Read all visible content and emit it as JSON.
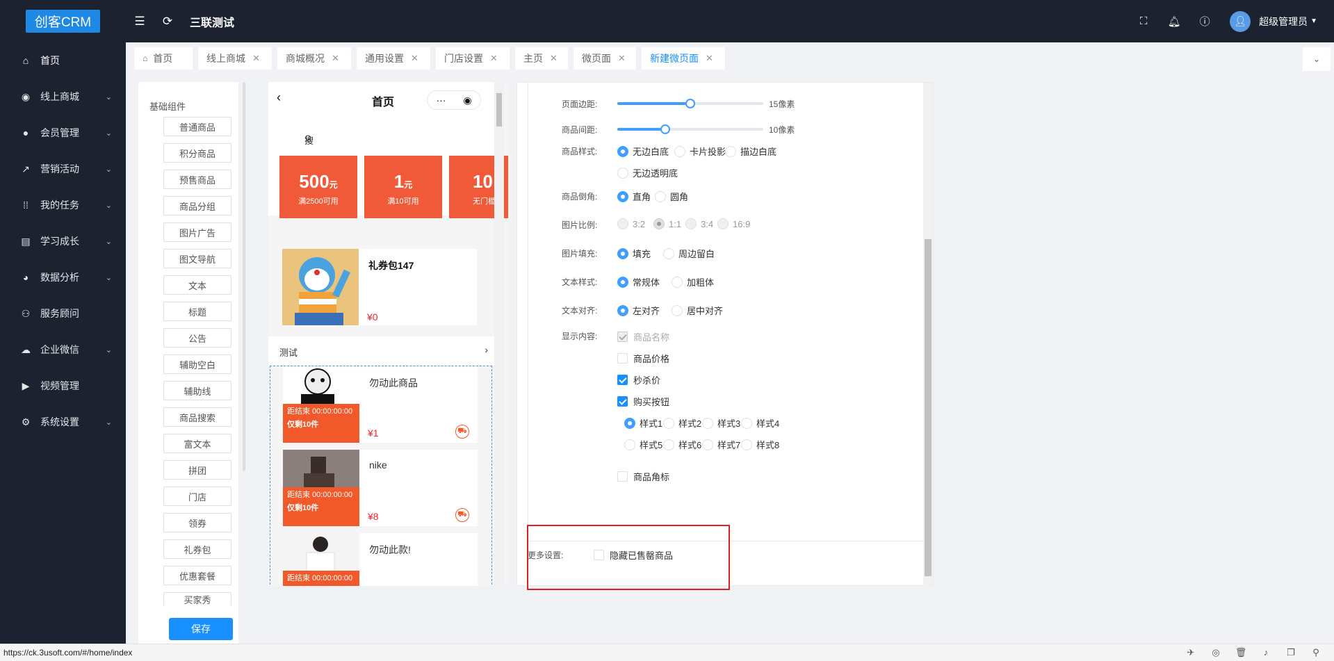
{
  "app": {
    "logo": "创客CRM",
    "store_title": "三联测试",
    "user_name": "超级管理员",
    "url": "https://ck.3usoft.com/#/home/index"
  },
  "sidebar": {
    "items": [
      {
        "label": "首页",
        "icon": "home-icon"
      },
      {
        "label": "线上商城",
        "icon": "store-icon"
      },
      {
        "label": "会员管理",
        "icon": "user-icon"
      },
      {
        "label": "营销活动",
        "icon": "trend-icon"
      },
      {
        "label": "我的任务",
        "icon": "grid-icon"
      },
      {
        "label": "学习成长",
        "icon": "book-icon"
      },
      {
        "label": "数据分析",
        "icon": "chart-icon"
      },
      {
        "label": "服务顾问",
        "icon": "people-icon"
      },
      {
        "label": "企业微信",
        "icon": "wechat-icon"
      },
      {
        "label": "视频管理",
        "icon": "video-icon"
      },
      {
        "label": "系统设置",
        "icon": "gear-icon"
      }
    ]
  },
  "tabs": [
    {
      "label": "首页"
    },
    {
      "label": "线上商城"
    },
    {
      "label": "商城概况"
    },
    {
      "label": "通用设置"
    },
    {
      "label": "门店设置"
    },
    {
      "label": "主页"
    },
    {
      "label": "微页面"
    },
    {
      "label": "新建微页面"
    }
  ],
  "components": {
    "title": "基础组件",
    "items": [
      "普通商品",
      "积分商品",
      "预售商品",
      "商品分组",
      "图片广告",
      "图文导航",
      "文本",
      "标题",
      "公告",
      "辅助空白",
      "辅助线",
      "商品搜索",
      "富文本",
      "拼团",
      "门店",
      "领券",
      "礼券包",
      "优惠套餐",
      "买家秀"
    ],
    "save_label": "保存"
  },
  "preview": {
    "page_title": "首页",
    "capsule_more": "···",
    "search_placeholder": "搜索商品",
    "coupons": [
      {
        "amount": "500",
        "unit": "元",
        "condition": "满2500可用"
      },
      {
        "amount": "1",
        "unit": "元",
        "condition": "满10可用"
      },
      {
        "amount": "10",
        "unit": "",
        "condition": "无门槛"
      }
    ],
    "gift": {
      "name": "礼券包147",
      "price": "¥0"
    },
    "section_title": "测试",
    "products": [
      {
        "name": "勿动此商品",
        "countdown": "距结束  00:00:00:00",
        "stock": "仅剩10件",
        "price": "¥1"
      },
      {
        "name": "nike",
        "countdown": "距结束  00:00:00:00",
        "stock": "仅剩10件",
        "price": "¥8"
      },
      {
        "name": "勿动此款!",
        "countdown": "距结束  00:00:00:00",
        "stock": "",
        "price": ""
      }
    ]
  },
  "settings": {
    "page_margin": {
      "label": "页面边距:",
      "value": "15像素",
      "level": 0.5
    },
    "item_gap": {
      "label": "商品间距:",
      "value": "10像素",
      "level": 0.33
    },
    "item_style": {
      "label": "商品样式:",
      "options": [
        "无边白底",
        "卡片投影",
        "描边白底",
        "无边透明底"
      ],
      "selected": 0
    },
    "corner": {
      "label": "商品倒角:",
      "options": [
        "直角",
        "圆角"
      ],
      "selected": 0
    },
    "ratio": {
      "label": "图片比例:",
      "options": [
        "3:2",
        "1:1",
        "3:4",
        "16:9"
      ],
      "selected": 1
    },
    "fill": {
      "label": "图片填充:",
      "options": [
        "填充",
        "周边留白"
      ],
      "selected": 0
    },
    "text_style": {
      "label": "文本样式:",
      "options": [
        "常规体",
        "加粗体"
      ],
      "selected": 0
    },
    "text_align": {
      "label": "文本对齐:",
      "options": [
        "左对齐",
        "居中对齐"
      ],
      "selected": 0
    },
    "display": {
      "label": "显示内容:",
      "items": [
        {
          "label": "商品名称",
          "checked": true,
          "disabled": true
        },
        {
          "label": "商品价格",
          "checked": false
        },
        {
          "label": "秒杀价",
          "checked": true
        },
        {
          "label": "购买按钮",
          "checked": true
        }
      ],
      "button_styles": [
        "样式1",
        "样式2",
        "样式3",
        "样式4",
        "样式5",
        "样式6",
        "样式7",
        "样式8"
      ],
      "button_style_selected": 0,
      "corner_tag": {
        "label": "商品角标",
        "checked": false
      }
    },
    "more": {
      "label": "更多设置:",
      "hide_sold_out": "隐藏已售罄商品",
      "checked": false
    }
  }
}
